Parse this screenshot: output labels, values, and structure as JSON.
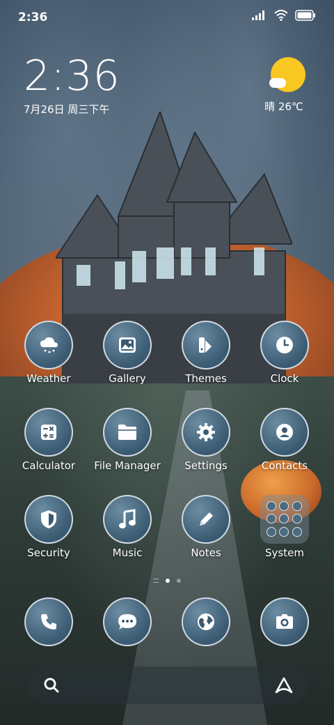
{
  "status_bar": {
    "time": "2:36"
  },
  "clock_widget": {
    "time": "2:36",
    "date": "7月26日 周三下午"
  },
  "weather_widget": {
    "text": "晴 26℃",
    "sun_color": "#f8c722"
  },
  "apps": [
    {
      "label": "Weather",
      "icon": "weather-icon"
    },
    {
      "label": "Gallery",
      "icon": "gallery-icon"
    },
    {
      "label": "Themes",
      "icon": "themes-icon"
    },
    {
      "label": "Clock",
      "icon": "clock-icon"
    },
    {
      "label": "Calculator",
      "icon": "calculator-icon"
    },
    {
      "label": "File Manager",
      "icon": "folder-icon"
    },
    {
      "label": "Settings",
      "icon": "gear-icon"
    },
    {
      "label": "Contacts",
      "icon": "contacts-icon"
    },
    {
      "label": "Security",
      "icon": "shield-icon"
    },
    {
      "label": "Music",
      "icon": "music-icon"
    },
    {
      "label": "Notes",
      "icon": "pencil-icon"
    },
    {
      "label": "System",
      "icon": "folder-grid-icon"
    }
  ],
  "dock": [
    {
      "icon": "phone-icon"
    },
    {
      "icon": "messages-icon"
    },
    {
      "icon": "browser-icon"
    },
    {
      "icon": "camera-icon"
    }
  ],
  "page_indicator": {
    "pages": 2,
    "active": 1
  },
  "search_bar": {
    "left_icon": "search-icon",
    "right_icon": "assistant-icon"
  }
}
